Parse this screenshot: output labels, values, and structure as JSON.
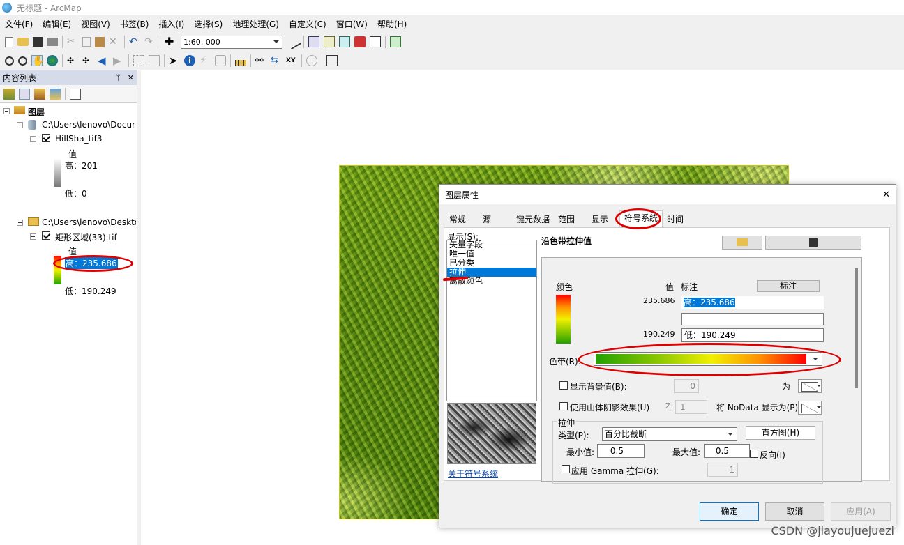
{
  "window": {
    "title": "无标题 - ArcMap"
  },
  "menu": [
    "文件(F)",
    "编辑(E)",
    "视图(V)",
    "书签(B)",
    "插入(I)",
    "选择(S)",
    "地理处理(G)",
    "自定义(C)",
    "窗口(W)",
    "帮助(H)"
  ],
  "toolbar": {
    "scale": "1:60, 000"
  },
  "toc": {
    "title": "内容列表",
    "pin": "ᛘ",
    "close": "✕",
    "root": "图层",
    "layer1": {
      "path": "C:\\Users\\lenovo\\Docur",
      "name": "HillSha_tif3",
      "value_label": "值",
      "high": "高：201",
      "low": "低：0"
    },
    "layer2": {
      "path": "C:\\Users\\lenovo\\Deskto",
      "name": "矩形区域(33).tif",
      "value_label": "值",
      "high": "高：235.686",
      "low": "低：190.249"
    }
  },
  "dialog": {
    "title": "图层属性",
    "close": "✕",
    "tabs": [
      "常规",
      "源",
      "键元数据",
      "范围",
      "显示",
      "符号系统",
      "时间"
    ],
    "show_label": "显示(S):",
    "render_options": [
      "矢量字段",
      "唯一值",
      "已分类",
      "拉伸",
      "离散颜色"
    ],
    "about_link": "关于符号系统",
    "heading": "沿色带拉伸值",
    "col_color": "颜色",
    "col_value": "值",
    "col_label": "标注",
    "label_button": "标注",
    "high_value": "235.686",
    "high_label": "高：235.686",
    "low_value": "190.249",
    "low_label": "低：190.249",
    "color_ramp_label": "色带(R):",
    "bg_check": "显示背景值(B):",
    "bg_value": "0",
    "as_label": "为",
    "hillshade_check": "使用山体阴影效果(U)",
    "z_label": "Z:",
    "z_value": "1",
    "nodata_label": "将 NoData 显示为(P)",
    "stretch_group": "拉伸",
    "type_label": "类型(P):",
    "type_value": "百分比截断",
    "histogram_button": "直方图(H)",
    "min_label": "最小值:",
    "min_value": "0.5",
    "max_label": "最大值:",
    "max_value": "0.5",
    "invert_check": "反向(I)",
    "gamma_check": "应用 Gamma 拉伸(G):",
    "gamma_value": "1",
    "ok": "确定",
    "cancel": "取消",
    "apply": "应用(A)"
  },
  "watermark": "CSDN @jiayoujuejuezi"
}
